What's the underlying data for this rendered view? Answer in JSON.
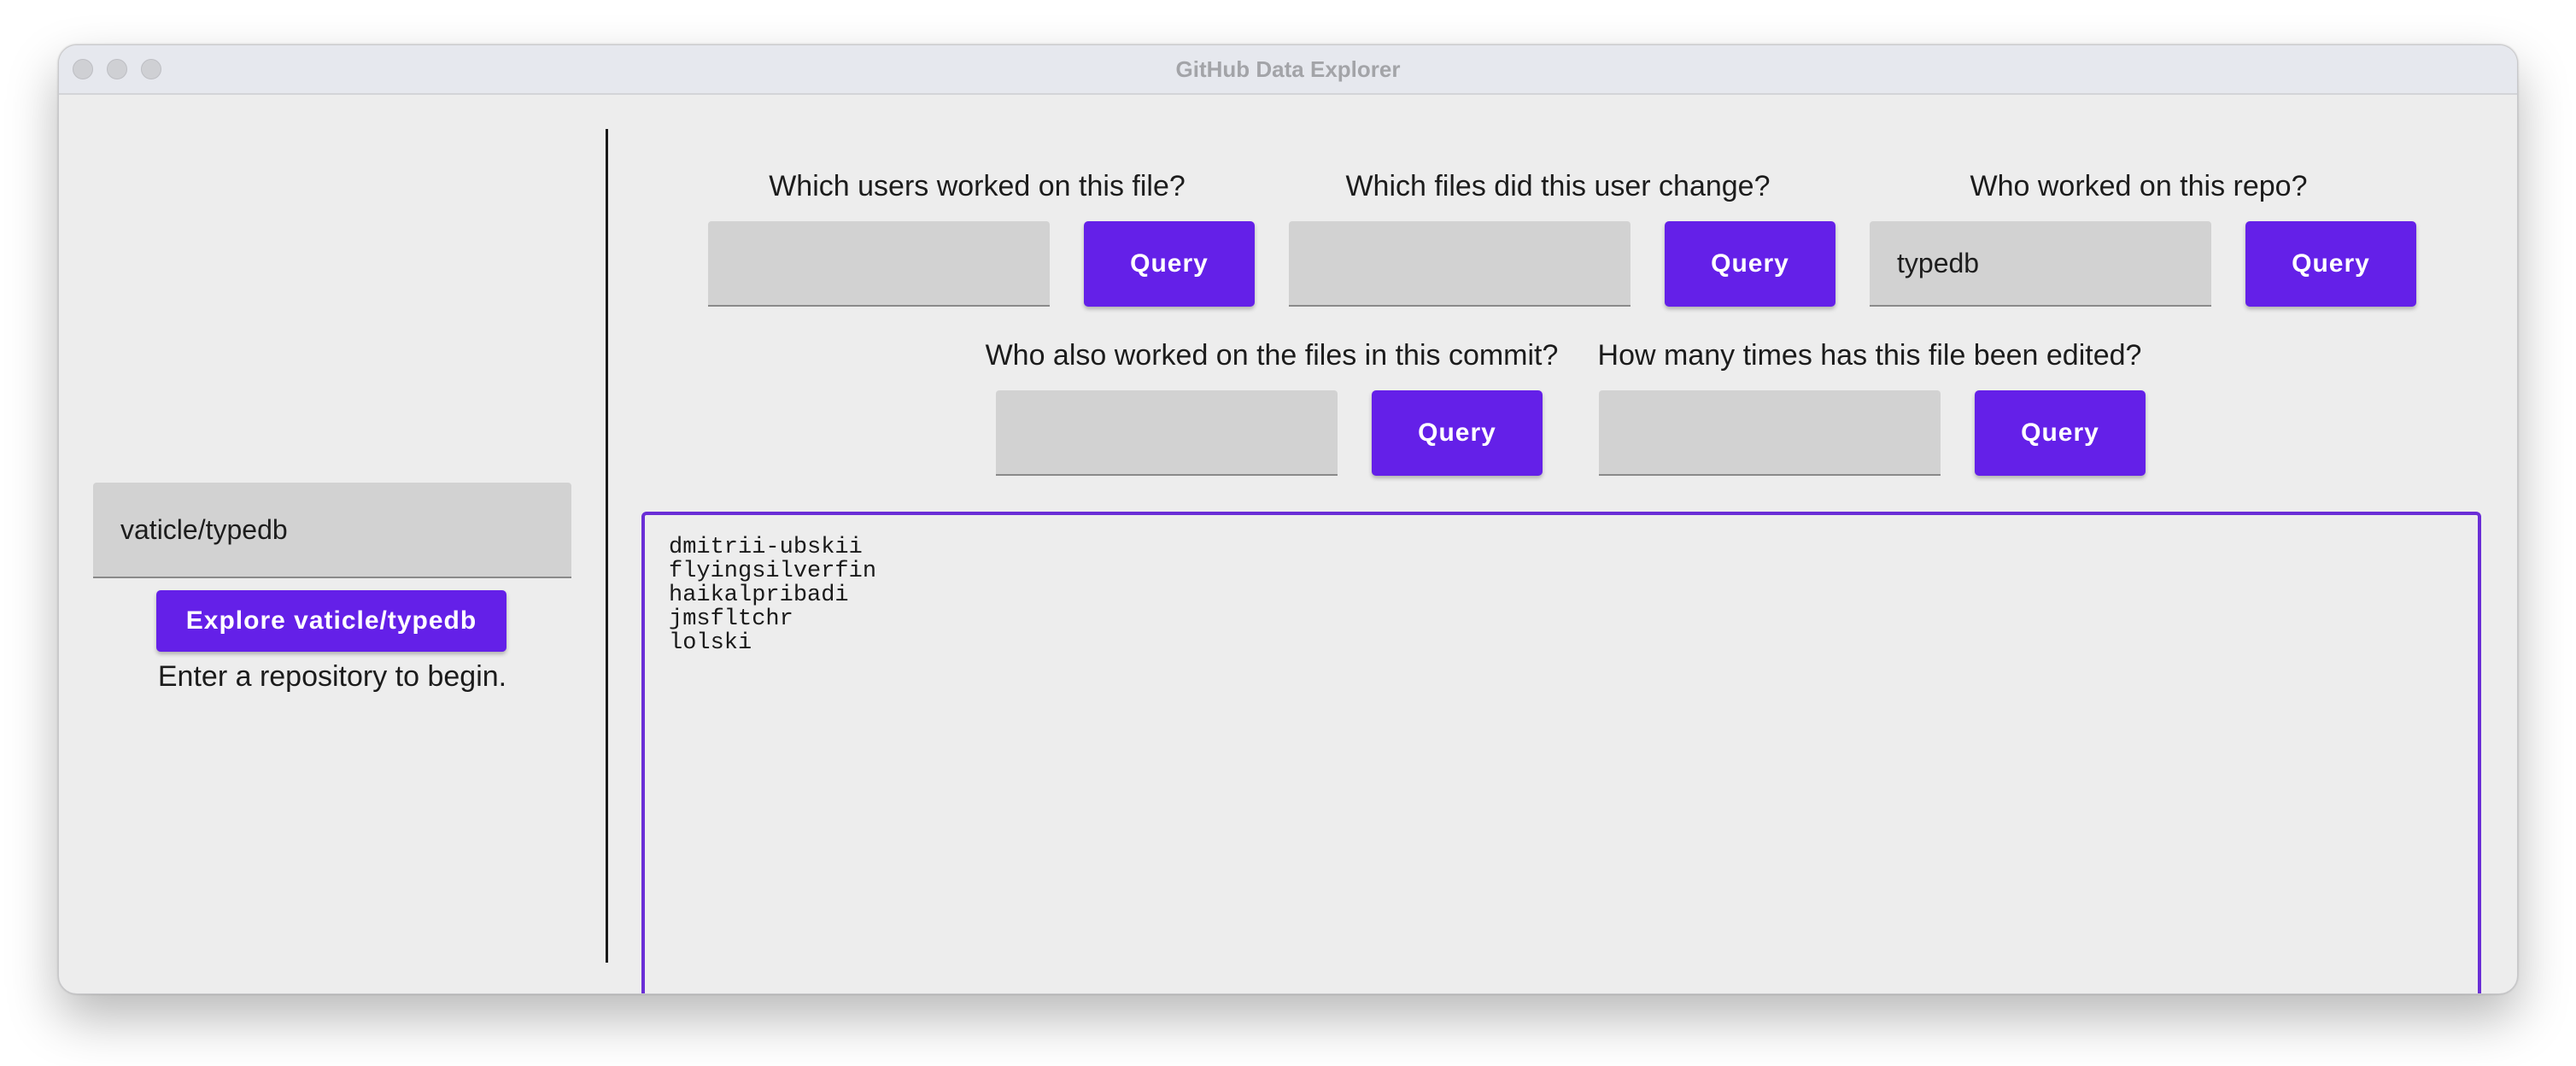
{
  "window": {
    "title": "GitHub Data Explorer"
  },
  "sidebar": {
    "repo_input_value": "vaticle/typedb",
    "explore_button_label": "Explore vaticle/typedb",
    "status_text": "Enter a repository to begin."
  },
  "queries": [
    {
      "question": "Which users worked on this file?",
      "input_value": "",
      "button_label": "Query"
    },
    {
      "question": "Which files did this user change?",
      "input_value": "",
      "button_label": "Query"
    },
    {
      "question": "Who worked on this repo?",
      "input_value": "typedb",
      "button_label": "Query"
    },
    {
      "question": "Who also worked on the files in this commit?",
      "input_value": "",
      "button_label": "Query"
    },
    {
      "question": "How many times has this file been edited?",
      "input_value": "",
      "button_label": "Query"
    }
  ],
  "results": {
    "lines": [
      "dmitrii-ubskii",
      "flyingsilverfin",
      "haikalpribadi",
      "jmsfltchr",
      "lolski"
    ]
  },
  "colors": {
    "accent": "#6420e8",
    "results_border": "#6a2ed6",
    "field_background": "#d2d2d2"
  }
}
